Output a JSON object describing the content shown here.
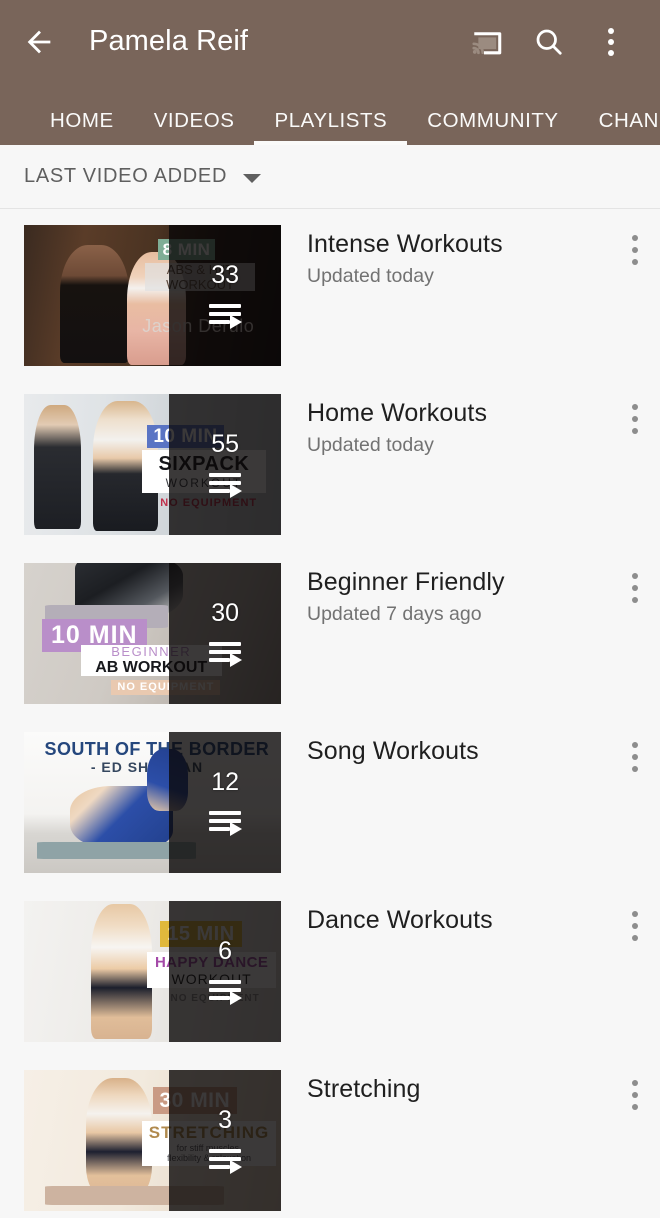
{
  "header": {
    "title": "Pamela Reif",
    "back_icon": "back-arrow-icon",
    "cast_icon": "cast-icon",
    "search_icon": "search-icon",
    "overflow_icon": "more-vertical-icon",
    "background_color": "#79655a"
  },
  "tabs": [
    {
      "label": "HOME",
      "active": false
    },
    {
      "label": "VIDEOS",
      "active": false
    },
    {
      "label": "PLAYLISTS",
      "active": true
    },
    {
      "label": "COMMUNITY",
      "active": false
    },
    {
      "label": "CHANNELS",
      "active": false
    }
  ],
  "sort": {
    "label": "LAST VIDEO ADDED",
    "caret_icon": "chevron-down-icon"
  },
  "playlists": [
    {
      "title": "Intense Workouts",
      "subtitle": "Updated today",
      "count": "33",
      "overlay_icon": "playlist-play-icon",
      "menu_icon": "more-vertical-icon",
      "thumb": {
        "theme": "dark-wood",
        "time_badge": "8 MIN",
        "time_badge_color": "#7fae96",
        "card_line1": "ABS & HIIT",
        "card_line2": "WORKOUT",
        "artist": "Jason Derulo"
      }
    },
    {
      "title": "Home Workouts",
      "subtitle": "Updated today",
      "count": "55",
      "overlay_icon": "playlist-play-icon",
      "menu_icon": "more-vertical-icon",
      "thumb": {
        "theme": "bright-gym",
        "time_badge": "10 MIN",
        "time_badge_color": "#5a74c4",
        "card_line1": "SIXPACK",
        "card_line2": "WORKOUT",
        "card_line3": "NO EQUIPMENT"
      }
    },
    {
      "title": "Beginner Friendly",
      "subtitle": "Updated 7 days ago",
      "count": "30",
      "overlay_icon": "playlist-play-icon",
      "menu_icon": "more-vertical-icon",
      "thumb": {
        "theme": "grey-mat",
        "time_badge": "10 MIN",
        "time_badge_color": "#b98ec9",
        "card_line1": "BEGINNER",
        "card_line2": "AB WORKOUT",
        "card_line3": "NO EQUIPMENT"
      }
    },
    {
      "title": "Song Workouts",
      "subtitle": "",
      "count": "12",
      "overlay_icon": "playlist-play-icon",
      "menu_icon": "more-vertical-icon",
      "thumb": {
        "theme": "white-studio",
        "title_line1": "SOUTH OF THE BORDER",
        "title_line2": "- ED SHEERAN",
        "title_color": "#25477d"
      }
    },
    {
      "title": "Dance Workouts",
      "subtitle": "",
      "count": "6",
      "overlay_icon": "playlist-play-icon",
      "menu_icon": "more-vertical-icon",
      "thumb": {
        "theme": "white-room",
        "time_badge": "15 MIN",
        "time_badge_color": "#e0b83c",
        "card_line1": "HAPPY DANCE",
        "card_line2": "WORKOUT",
        "card_line3": "NO EQUIPMENT"
      }
    },
    {
      "title": "Stretching",
      "subtitle": "",
      "count": "3",
      "overlay_icon": "playlist-play-icon",
      "menu_icon": "more-vertical-icon",
      "thumb": {
        "theme": "warm-room",
        "time_badge": "30 MIN",
        "time_badge_color": "#c99a84",
        "card_line1": "STRETCHING",
        "card_line2": "for stiff muscles,",
        "card_line3": "flexibility & relaxation"
      }
    }
  ]
}
